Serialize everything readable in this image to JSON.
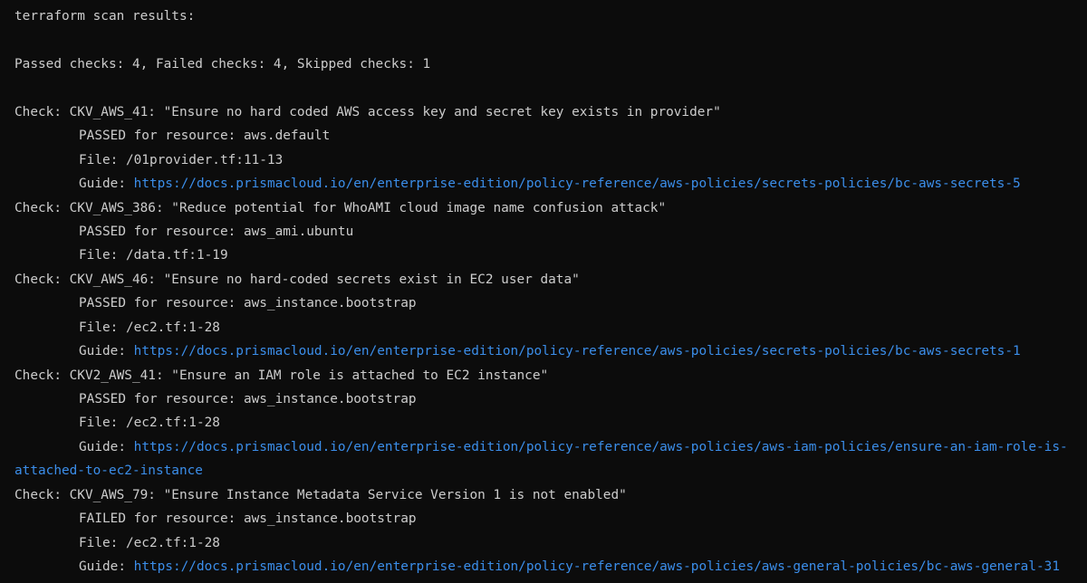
{
  "colors": {
    "background": "#0c0c0c",
    "text": "#cccccc",
    "link": "#3b8eea"
  },
  "header": {
    "title": "terraform scan results:",
    "summary": "Passed checks: 4, Failed checks: 4, Skipped checks: 1"
  },
  "checks": [
    {
      "check": "Check: CKV_AWS_41: \"Ensure no hard coded AWS access key and secret key exists in provider\"",
      "result": "PASSED for resource: aws.default",
      "file": "File: /01provider.tf:11-13",
      "guide_label": "Guide: ",
      "guide_url": "https://docs.prismacloud.io/en/enterprise-edition/policy-reference/aws-policies/secrets-policies/bc-aws-secrets-5"
    },
    {
      "check": "Check: CKV_AWS_386: \"Reduce potential for WhoAMI cloud image name confusion attack\"",
      "result": "PASSED for resource: aws_ami.ubuntu",
      "file": "File: /data.tf:1-19"
    },
    {
      "check": "Check: CKV_AWS_46: \"Ensure no hard-coded secrets exist in EC2 user data\"",
      "result": "PASSED for resource: aws_instance.bootstrap",
      "file": "File: /ec2.tf:1-28",
      "guide_label": "Guide: ",
      "guide_url": "https://docs.prismacloud.io/en/enterprise-edition/policy-reference/aws-policies/secrets-policies/bc-aws-secrets-1"
    },
    {
      "check": "Check: CKV2_AWS_41: \"Ensure an IAM role is attached to EC2 instance\"",
      "result": "PASSED for resource: aws_instance.bootstrap",
      "file": "File: /ec2.tf:1-28",
      "guide_label": "Guide: ",
      "guide_url": "https://docs.prismacloud.io/en/enterprise-edition/policy-reference/aws-policies/aws-iam-policies/ensure-an-iam-role-is-",
      "guide_url_cont": "attached-to-ec2-instance"
    },
    {
      "check": "Check: CKV_AWS_79: \"Ensure Instance Metadata Service Version 1 is not enabled\"",
      "result": "FAILED for resource: aws_instance.bootstrap",
      "file": "File: /ec2.tf:1-28",
      "guide_label": "Guide: ",
      "guide_url": "https://docs.prismacloud.io/en/enterprise-edition/policy-reference/aws-policies/aws-general-policies/bc-aws-general-31"
    }
  ]
}
